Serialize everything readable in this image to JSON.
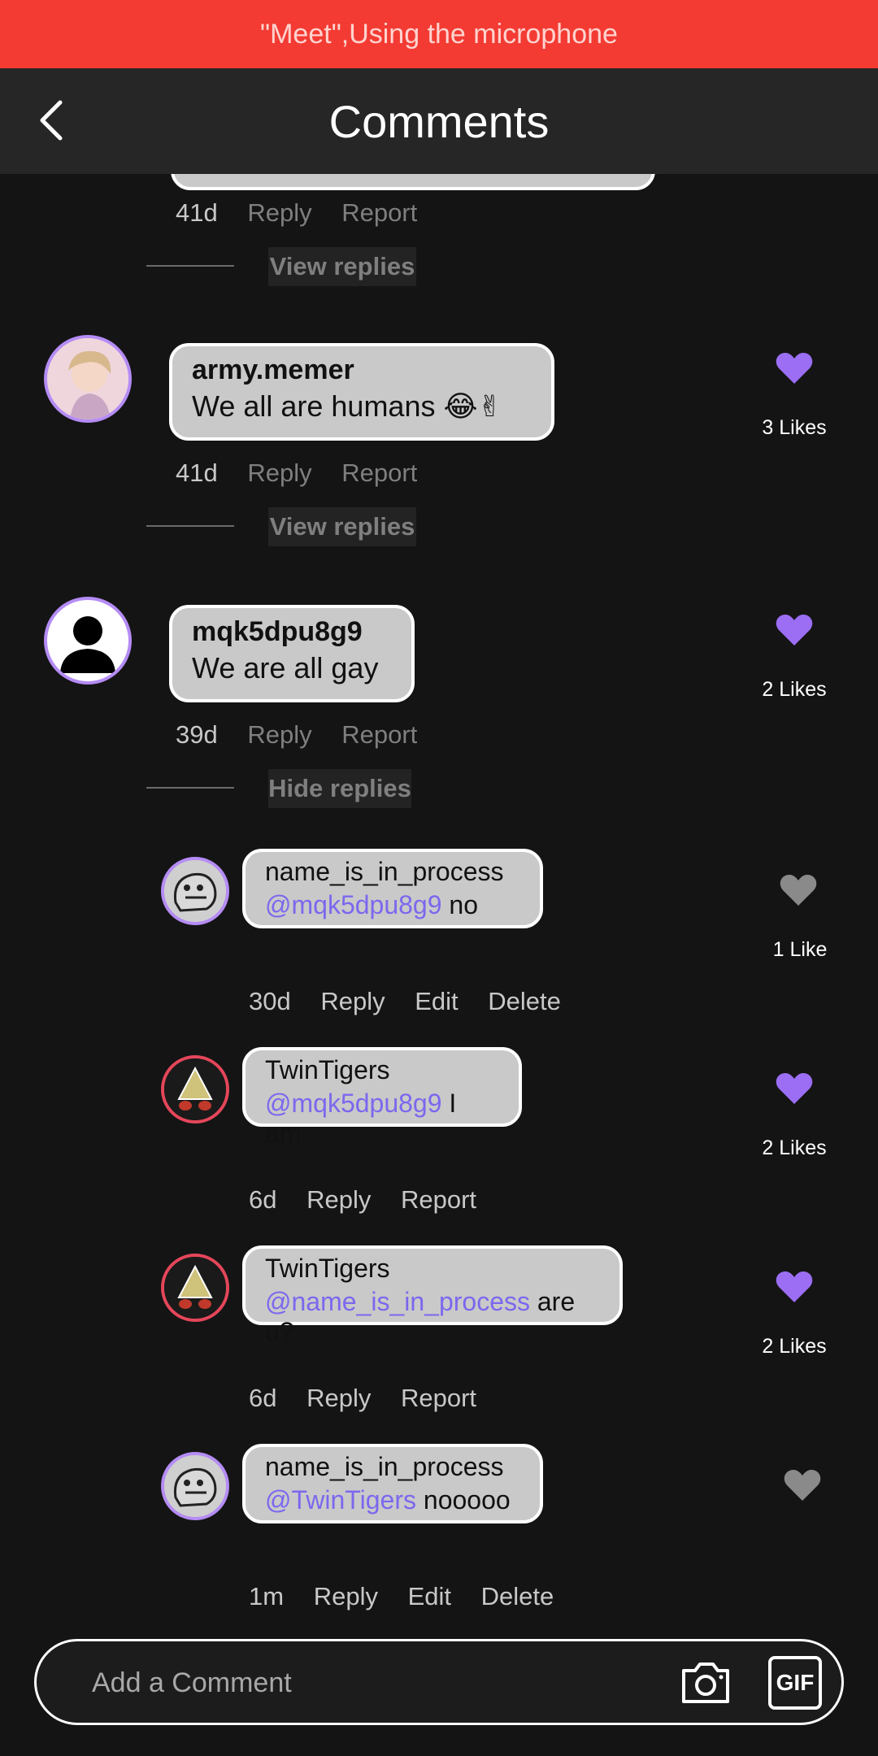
{
  "status_banner": "\"Meet\",Using the microphone",
  "header": {
    "title": "Comments"
  },
  "comments": [
    {
      "time": "41d",
      "reply": "Reply",
      "report": "Report",
      "toggle": "View replies"
    },
    {
      "username": "army.memer",
      "text": "We all are humans 😂✌",
      "time": "41d",
      "reply": "Reply",
      "report": "Report",
      "toggle": "View replies",
      "likes": "3 Likes"
    },
    {
      "username": "mqk5dpu8g9",
      "text": "We are all gay",
      "time": "39d",
      "reply": "Reply",
      "report": "Report",
      "toggle": "Hide replies",
      "likes": "2 Likes"
    }
  ],
  "replies": [
    {
      "username": "name_is_in_process",
      "mention": "@mqk5dpu8g9",
      "text": " no",
      "time": "30d",
      "a1": "Reply",
      "a2": "Edit",
      "a3": "Delete",
      "likes": "1 Like"
    },
    {
      "username": "TwinTigers",
      "mention": "@mqk5dpu8g9",
      "text": " I am",
      "time": "6d",
      "a1": "Reply",
      "a2": "Report",
      "likes": "2 Likes"
    },
    {
      "username": "TwinTigers",
      "mention": "@name_is_in_process",
      "text": " are u?",
      "time": "6d",
      "a1": "Reply",
      "a2": "Report",
      "likes": "2 Likes"
    },
    {
      "username": "name_is_in_process",
      "mention": "@TwinTigers",
      "text": " nooooo",
      "time": "1m",
      "a1": "Reply",
      "a2": "Edit",
      "a3": "Delete"
    }
  ],
  "composer": {
    "placeholder": "Add a Comment",
    "gif_label": "GIF"
  },
  "colors": {
    "accent": "#9b6ef3",
    "banner": "#f33b33",
    "mention": "#7b68ee"
  }
}
